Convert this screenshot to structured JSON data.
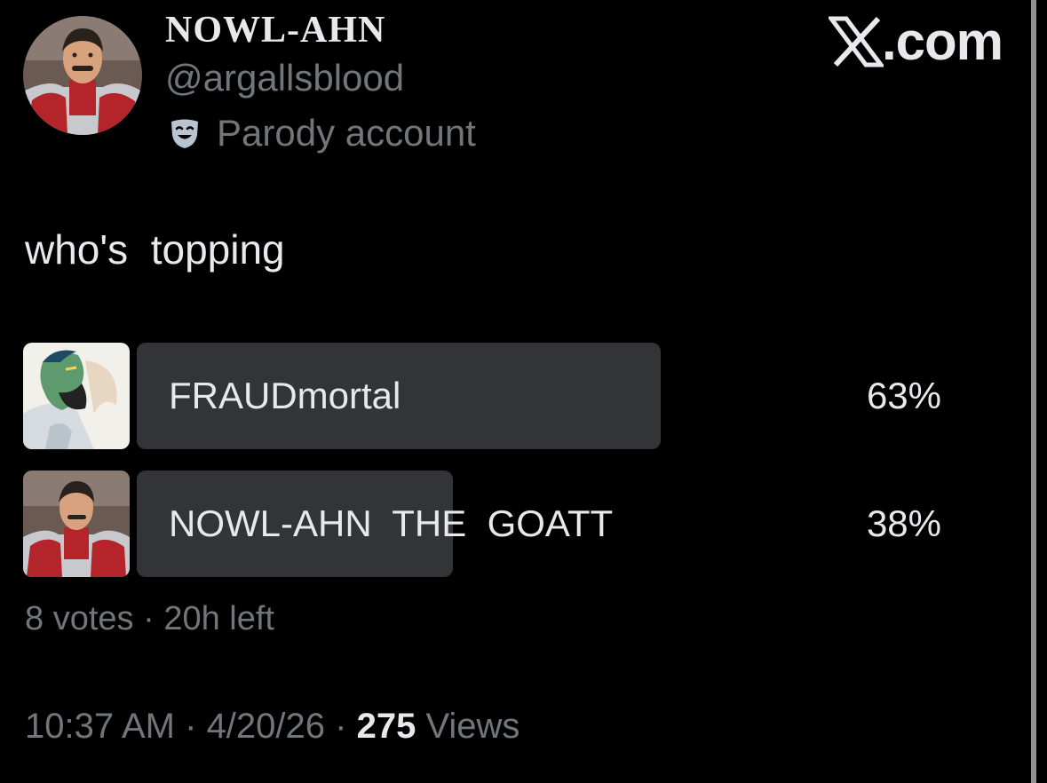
{
  "author": {
    "display_name": "NOWL-AHN",
    "handle": "@argallsblood",
    "label_icon": "theater-mask-icon",
    "label": "Parody account",
    "avatar": "avatar-illustration"
  },
  "brand": {
    "icon": "x-logo-icon",
    "text": ".com"
  },
  "tweet": {
    "text": "who's  topping"
  },
  "poll": {
    "options": [
      {
        "label": "FRAUDmortal",
        "percent_text": "63%",
        "percent": 63,
        "thumb": "option-image-green-hero"
      },
      {
        "label": "NOWL-AHN  THE  GOATT",
        "percent_text": "38%",
        "percent": 38,
        "thumb": "option-image-red-hero"
      }
    ],
    "meta": {
      "votes": "8 votes",
      "separator": " · ",
      "time_left": "20h left"
    }
  },
  "timestamp": {
    "time": "10:37 AM",
    "sep1": " · ",
    "date": "4/20/26",
    "sep2": " · ",
    "views_count": "275",
    "views_label": " Views"
  },
  "colors": {
    "background": "#000000",
    "text_primary": "#e7e9ea",
    "text_secondary": "#71767b",
    "poll_bar": "#333438"
  }
}
